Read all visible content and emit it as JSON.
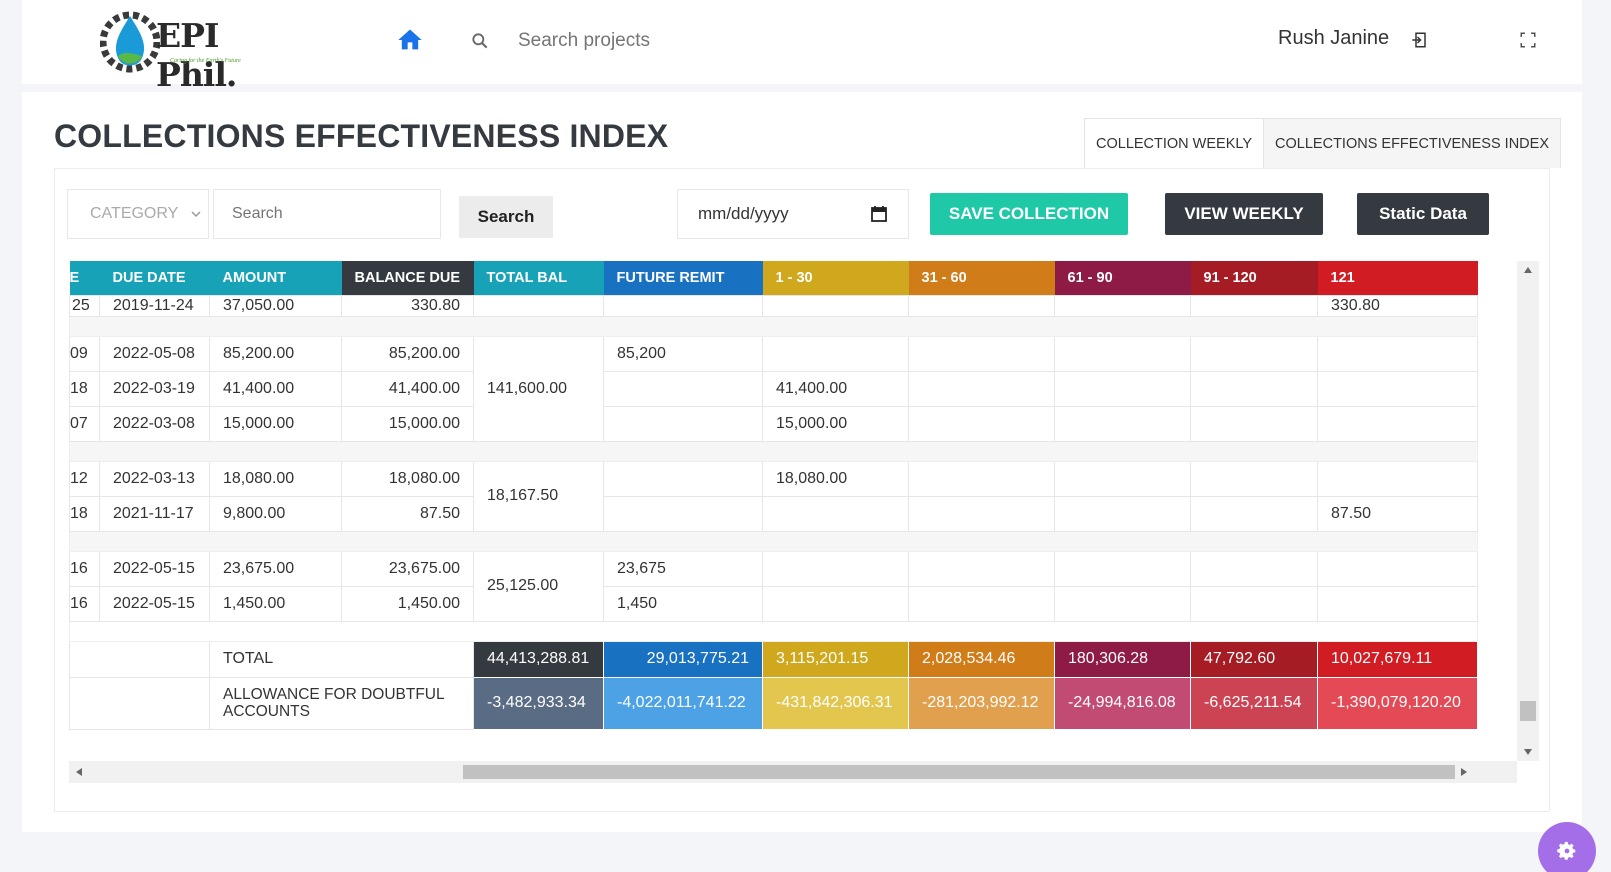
{
  "header": {
    "logo_text": "EPI Phil.",
    "logo_tagline": "Caring for the Earth's Future",
    "search_placeholder": "Search projects",
    "user_name": "Rush Janine"
  },
  "page": {
    "title": "COLLECTIONS EFFECTIVENESS INDEX",
    "tabs": [
      {
        "label": "COLLECTION WEEKLY",
        "active": true
      },
      {
        "label": "COLLECTIONS EFFECTIVENESS INDEX",
        "active": false
      }
    ]
  },
  "filters": {
    "category_placeholder": "CATEGORY",
    "search_placeholder": "Search",
    "search_button": "Search",
    "date_placeholder": "mm/dd/yyyy",
    "save_collection": "SAVE COLLECTION",
    "view_weekly": "VIEW WEEKLY",
    "static_data": "Static Data"
  },
  "table": {
    "headers": [
      "E",
      "DUE DATE",
      "AMOUNT",
      "BALANCE DUE",
      "TOTAL BAL",
      "FUTURE REMIT",
      "1 - 30",
      "31 - 60",
      "61 - 90",
      "91 - 120",
      "121"
    ],
    "partial_row": {
      "c0": "25",
      "due": "2019-11-24",
      "amount": "37,050.00",
      "balance": "330.80",
      "d121": "330.80"
    },
    "groups": [
      {
        "total_bal": "141,600.00",
        "rows": [
          {
            "c0": "09",
            "due": "2022-05-08",
            "amount": "85,200.00",
            "balance": "85,200.00",
            "future": "85,200",
            "d1_30": ""
          },
          {
            "c0": "18",
            "due": "2022-03-19",
            "amount": "41,400.00",
            "balance": "41,400.00",
            "future": "",
            "d1_30": "41,400.00"
          },
          {
            "c0": "07",
            "due": "2022-03-08",
            "amount": "15,000.00",
            "balance": "15,000.00",
            "future": "",
            "d1_30": "15,000.00"
          }
        ]
      },
      {
        "total_bal": "18,167.50",
        "rows": [
          {
            "c0": "12",
            "due": "2022-03-13",
            "amount": "18,080.00",
            "balance": "18,080.00",
            "future": "",
            "d1_30": "18,080.00",
            "d121": ""
          },
          {
            "c0": "18",
            "due": "2021-11-17",
            "amount": "9,800.00",
            "balance": "87.50",
            "future": "",
            "d1_30": "",
            "d121": "87.50"
          }
        ]
      },
      {
        "total_bal": "25,125.00",
        "rows": [
          {
            "c0": "16",
            "due": "2022-05-15",
            "amount": "23,675.00",
            "balance": "23,675.00",
            "future": "23,675"
          },
          {
            "c0": "16",
            "due": "2022-05-15",
            "amount": "1,450.00",
            "balance": "1,450.00",
            "future": "1,450"
          }
        ]
      }
    ],
    "total": {
      "label": "TOTAL",
      "values": [
        "44,413,288.81",
        "29,013,775.21",
        "3,115,201.15",
        "2,028,534.46",
        "180,306.28",
        "47,792.60",
        "10,027,679.11"
      ]
    },
    "allowance": {
      "label": "ALLOWANCE FOR DOUBTFUL ACCOUNTS",
      "values": [
        "-3,482,933.34",
        "-4,022,011,741.22",
        "-431,842,306.31",
        "-281,203,992.12",
        "-24,994,816.08",
        "-6,625,211.54",
        "-1,390,079,120.20"
      ]
    }
  },
  "colors": {
    "teal": "#17a2b8",
    "dark": "#343a40",
    "blue": "#1971c2",
    "yellow": "#cfa81d",
    "orange": "#d07c19",
    "maroon": "#8e1b46",
    "red_dark": "#a51c24",
    "red": "#d11c24",
    "save_button": "#1fc9a8",
    "settings_fab": "#a46ee9"
  },
  "icons": [
    "home-icon",
    "search-icon",
    "logout-icon",
    "fullscreen-icon",
    "calendar-icon",
    "chevron-down-icon",
    "gear-icon"
  ]
}
